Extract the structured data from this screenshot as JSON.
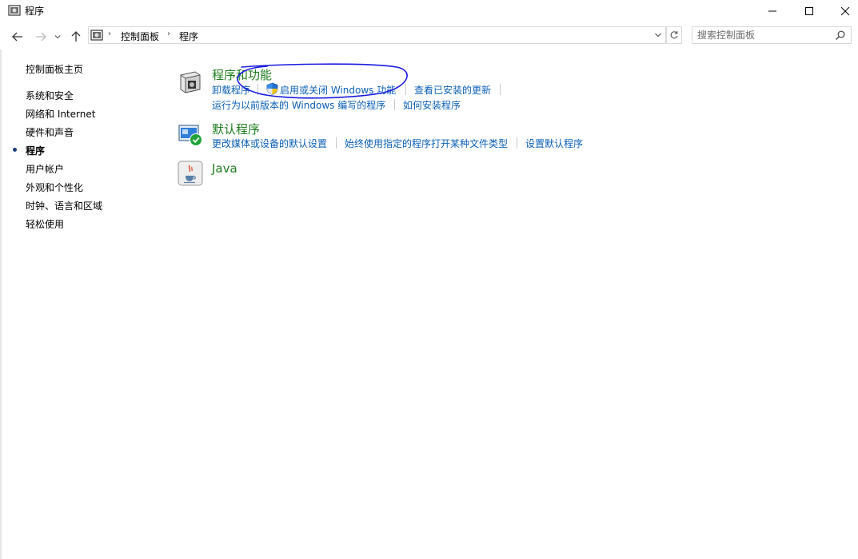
{
  "window": {
    "title": "程序"
  },
  "address": {
    "crumbs": [
      "控制面板",
      "程序"
    ]
  },
  "search": {
    "placeholder": "搜索控制面板"
  },
  "leftnav": {
    "items": [
      {
        "label": "控制面板主页"
      },
      {
        "label": "系统和安全"
      },
      {
        "label": "网络和 Internet"
      },
      {
        "label": "硬件和声音"
      },
      {
        "label": "程序",
        "current": true
      },
      {
        "label": "用户帐户"
      },
      {
        "label": "外观和个性化"
      },
      {
        "label": "时钟、语言和区域"
      },
      {
        "label": "轻松使用"
      }
    ]
  },
  "categories": [
    {
      "title": "程序和功能",
      "icon": "programs-features-icon",
      "links_row1": [
        "卸载程序",
        "启用或关闭 Windows 功能",
        "查看已安装的更新"
      ],
      "links_row2": [
        "运行为以前版本的 Windows 编写的程序",
        "如何安装程序"
      ]
    },
    {
      "title": "默认程序",
      "icon": "default-programs-icon",
      "links_row1": [
        "更改媒体或设备的默认设置",
        "始终使用指定的程序打开某种文件类型",
        "设置默认程序"
      ]
    },
    {
      "title": "Java",
      "icon": "java-icon"
    }
  ],
  "colors": {
    "category_title": "#1e7d1e",
    "link": "#0a5fb4",
    "annotation": "#1a1ae0"
  }
}
